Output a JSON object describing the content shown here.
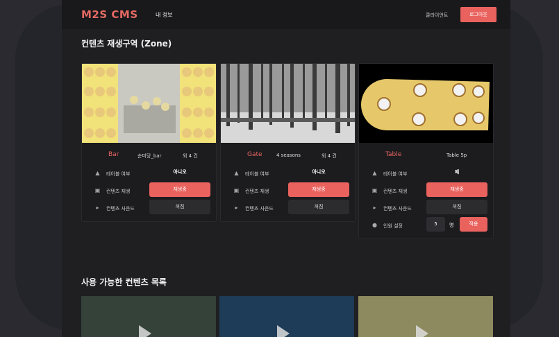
{
  "header": {
    "logo": "M2S CMS",
    "nav_my_info": "내 정보",
    "nav_client": "클라이언트",
    "logout_label": "로그아웃"
  },
  "zone_section": {
    "title": "컨텐츠 재생구역 (Zone)",
    "cards": [
      {
        "name": "Bar",
        "subtitle": "순미당_bar",
        "count": "외 4 건",
        "table_label": "테이블 여부",
        "table_value": "아니오",
        "play_label": "컨텐츠 재생",
        "play_value": "재생중",
        "sound_label": "컨텐츠 사운드",
        "sound_value": "꺼짐"
      },
      {
        "name": "Gate",
        "subtitle": "4 seasons",
        "count": "외 4 건",
        "table_label": "테이블 여부",
        "table_value": "아니오",
        "play_label": "컨텐츠 재생",
        "play_value": "재생중",
        "sound_label": "컨텐츠 사운드",
        "sound_value": "꺼짐"
      },
      {
        "name": "Table",
        "subtitle": "Table 5p",
        "count": "",
        "table_label": "테이블 여부",
        "table_value": "예",
        "play_label": "컨텐츠 재생",
        "play_value": "재생중",
        "sound_label": "컨텐츠 사운드",
        "sound_value": "꺼짐",
        "people_label": "인원 설정",
        "people_value": "5",
        "people_unit": "명",
        "apply_label": "적용"
      }
    ]
  },
  "library_section": {
    "title": "사용 가능한 컨텐츠 목록"
  },
  "colors": {
    "accent": "#e9625e",
    "background": "#1f1f22",
    "card": "#1c1c1f"
  }
}
